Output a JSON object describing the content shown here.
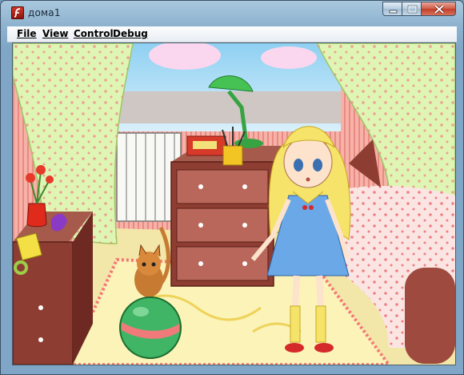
{
  "window": {
    "title": "дома1",
    "icon": "flash-player-icon"
  },
  "title_controls": {
    "minimize": "minimize-icon",
    "maximize": "maximize-icon",
    "close": "close-icon"
  },
  "menu": {
    "items": [
      {
        "label": "File"
      },
      {
        "label": "View"
      },
      {
        "label": "Control"
      },
      {
        "label": "Debug"
      }
    ]
  },
  "scene": {
    "description_free": true,
    "colors": {
      "wall": "#f3a8a0",
      "curtain": "#dff5b4",
      "dresser": "#8e3d32",
      "rug": "#fbf3b8",
      "dress": "#6aa8e8",
      "hair": "#f6e36a",
      "ball_green": "#3fb565",
      "ball_stripe": "#f07a7a"
    }
  }
}
